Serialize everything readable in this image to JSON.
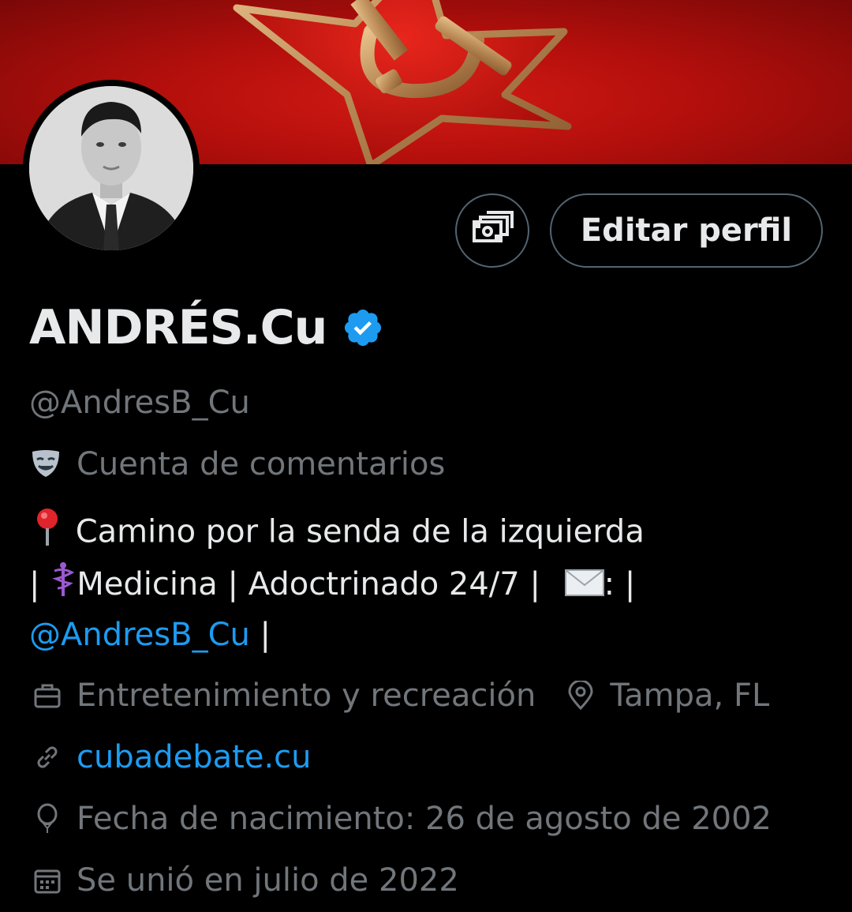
{
  "profile": {
    "display_name": "ANDRÉS.Cu",
    "handle": "@AndresB_Cu",
    "category": "Cuenta de comentarios",
    "bio_line1": "Camino por la senda de la izquierda",
    "bio_sep1": "|",
    "bio_medicine": "Medicina | Adoctrinado 24/7 |",
    "bio_mail_sep": ": |",
    "bio_mention": "@AndresB_Cu",
    "bio_end": " |",
    "profession": "Entretenimiento y recreación",
    "location": "Tampa, FL",
    "website": "cubadebate.cu",
    "birthdate": "Fecha de nacimiento: 26 de agosto de 2002",
    "joined": "Se unió en julio de 2022"
  },
  "buttons": {
    "edit_profile": "Editar perfil",
    "tips_icon": "money-icon"
  },
  "colors": {
    "background": "#000000",
    "text_primary": "#e7e9ea",
    "text_secondary": "#71767b",
    "link": "#1d9bf0",
    "verified": "#1d9bf0",
    "button_border": "#536471",
    "banner": "#c8120f"
  }
}
